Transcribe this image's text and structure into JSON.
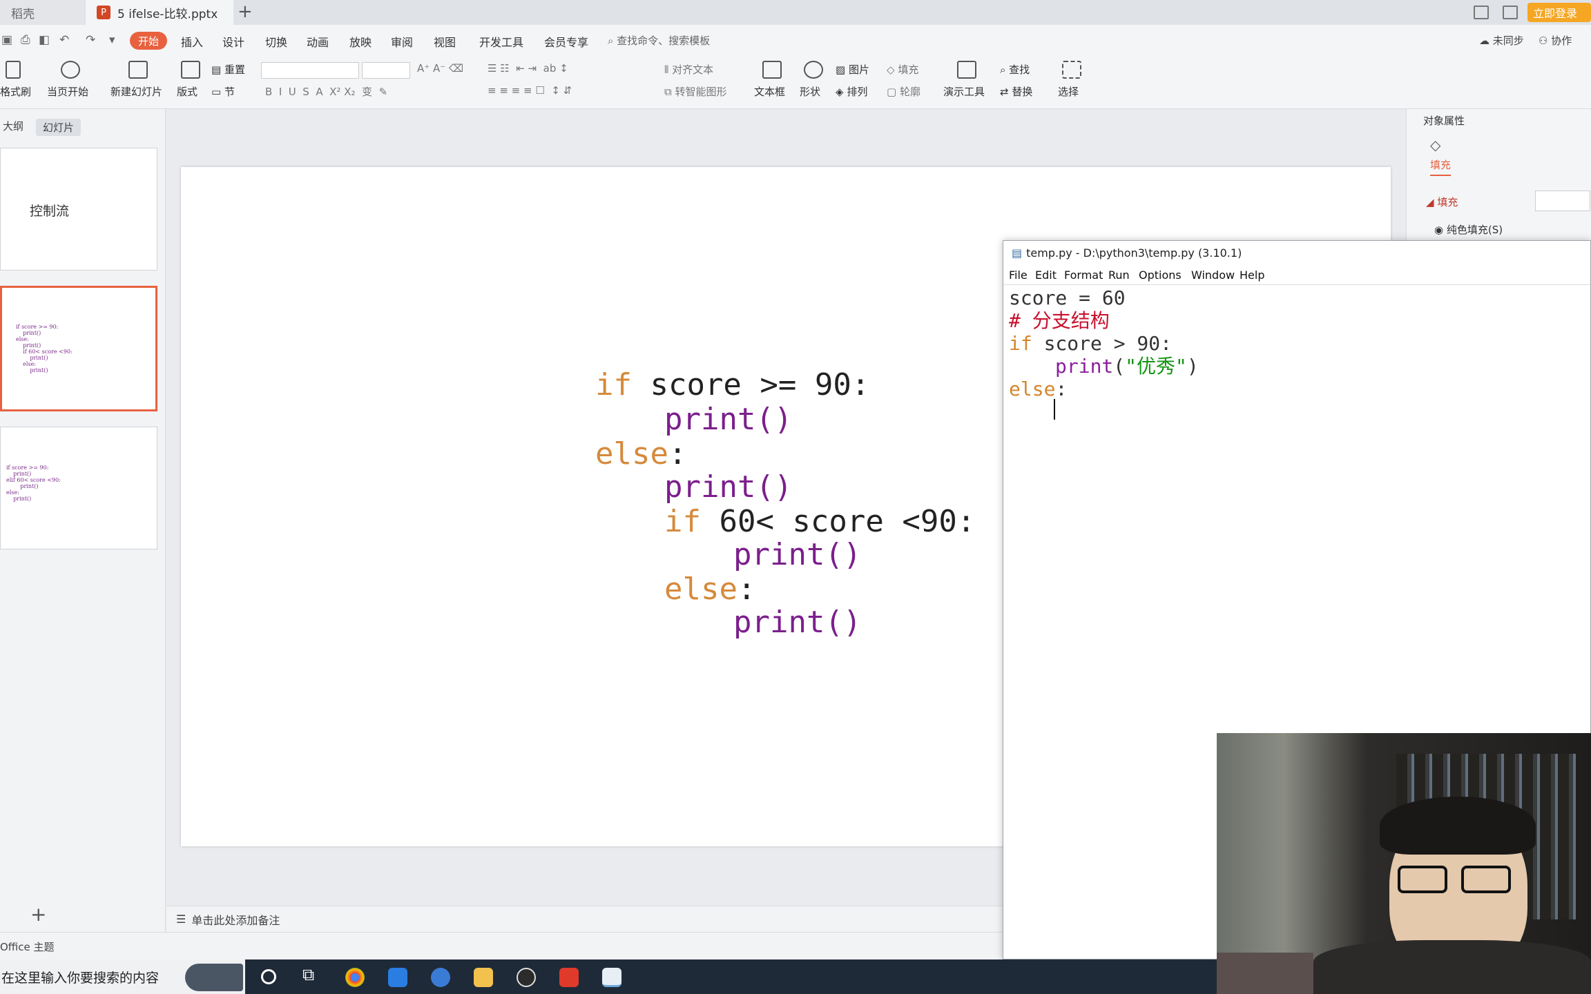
{
  "window": {
    "tab_inactive": "稻壳",
    "tab_active": "5 ifelse-比较.pptx",
    "tab_add": "+",
    "login": "立即登录"
  },
  "menubar": {
    "items": [
      "开始",
      "插入",
      "设计",
      "切换",
      "动画",
      "放映",
      "审阅",
      "视图",
      "开发工具",
      "会员专享"
    ],
    "search_placeholder": "查找命令、搜索模板",
    "sync": "未同步",
    "collab": "协作"
  },
  "ribbon": {
    "format_painter": "格式刷",
    "play_from_current": "当页开始",
    "new_slide": "新建幻灯片",
    "layout": "版式",
    "section": "节",
    "reset": "重置",
    "align_text": "对齐文本",
    "smart_shape": "转智能图形",
    "textbox": "文本框",
    "shape": "形状",
    "picture": "图片",
    "fill": "填充",
    "arrange": "排列",
    "outline": "轮廓",
    "present_tools": "演示工具",
    "find": "查找",
    "replace": "替换",
    "select": "选择"
  },
  "left_panel": {
    "tab_outline": "大纲",
    "tab_slides": "幻灯片",
    "slide1_title": "控制流",
    "slide2_code": "if score >= 90:\n    print()\nelse:\n    print()\n    if 60< score <90:\n        print()\n    else:\n        print()",
    "slide3_code": "if score >= 90:\n    print()\nelif 60< score <90:\n        print()\nelse:\n    print()",
    "add": "+"
  },
  "slide": {
    "lines": [
      {
        "kw": "if",
        "rest": " score >= 90:"
      },
      {
        "fn": "print()"
      },
      {
        "kw": "else",
        "rest": ":"
      },
      {
        "fn": "print()"
      },
      {
        "kw": "if",
        "rest": " 60< score <90:"
      },
      {
        "fn": "print()"
      },
      {
        "kw": "else",
        "rest": ":"
      },
      {
        "fn": "print()"
      }
    ]
  },
  "notes": {
    "placeholder": "单击此处添加备注"
  },
  "status": {
    "theme": "Office 主题"
  },
  "right_panel": {
    "title": "对象属性",
    "tab_fill": "填充",
    "section_fill": "填充",
    "solid_fill": "纯色填充(S)"
  },
  "idle": {
    "title": "temp.py - D:\\python3\\temp.py (3.10.1)",
    "menu": [
      "File",
      "Edit",
      "Format",
      "Run",
      "Options",
      "Window",
      "Help"
    ],
    "code": {
      "l1": "score = 60",
      "l2": "# 分支结构",
      "l3_kw": "if",
      "l3_rest": " score > 90:",
      "l4_fn": "print",
      "l4_p1": "(",
      "l4_str": "\"优秀\"",
      "l4_p2": ")",
      "l5_kw": "else",
      "l5_rest": ":"
    }
  },
  "taskbar": {
    "search": "在这里输入你要搜索的内容"
  },
  "colors": {
    "accent": "#e8613f",
    "keyword": "#d58a3c",
    "function": "#7b1f8c",
    "string": "#139413",
    "comment": "#c8102e"
  }
}
